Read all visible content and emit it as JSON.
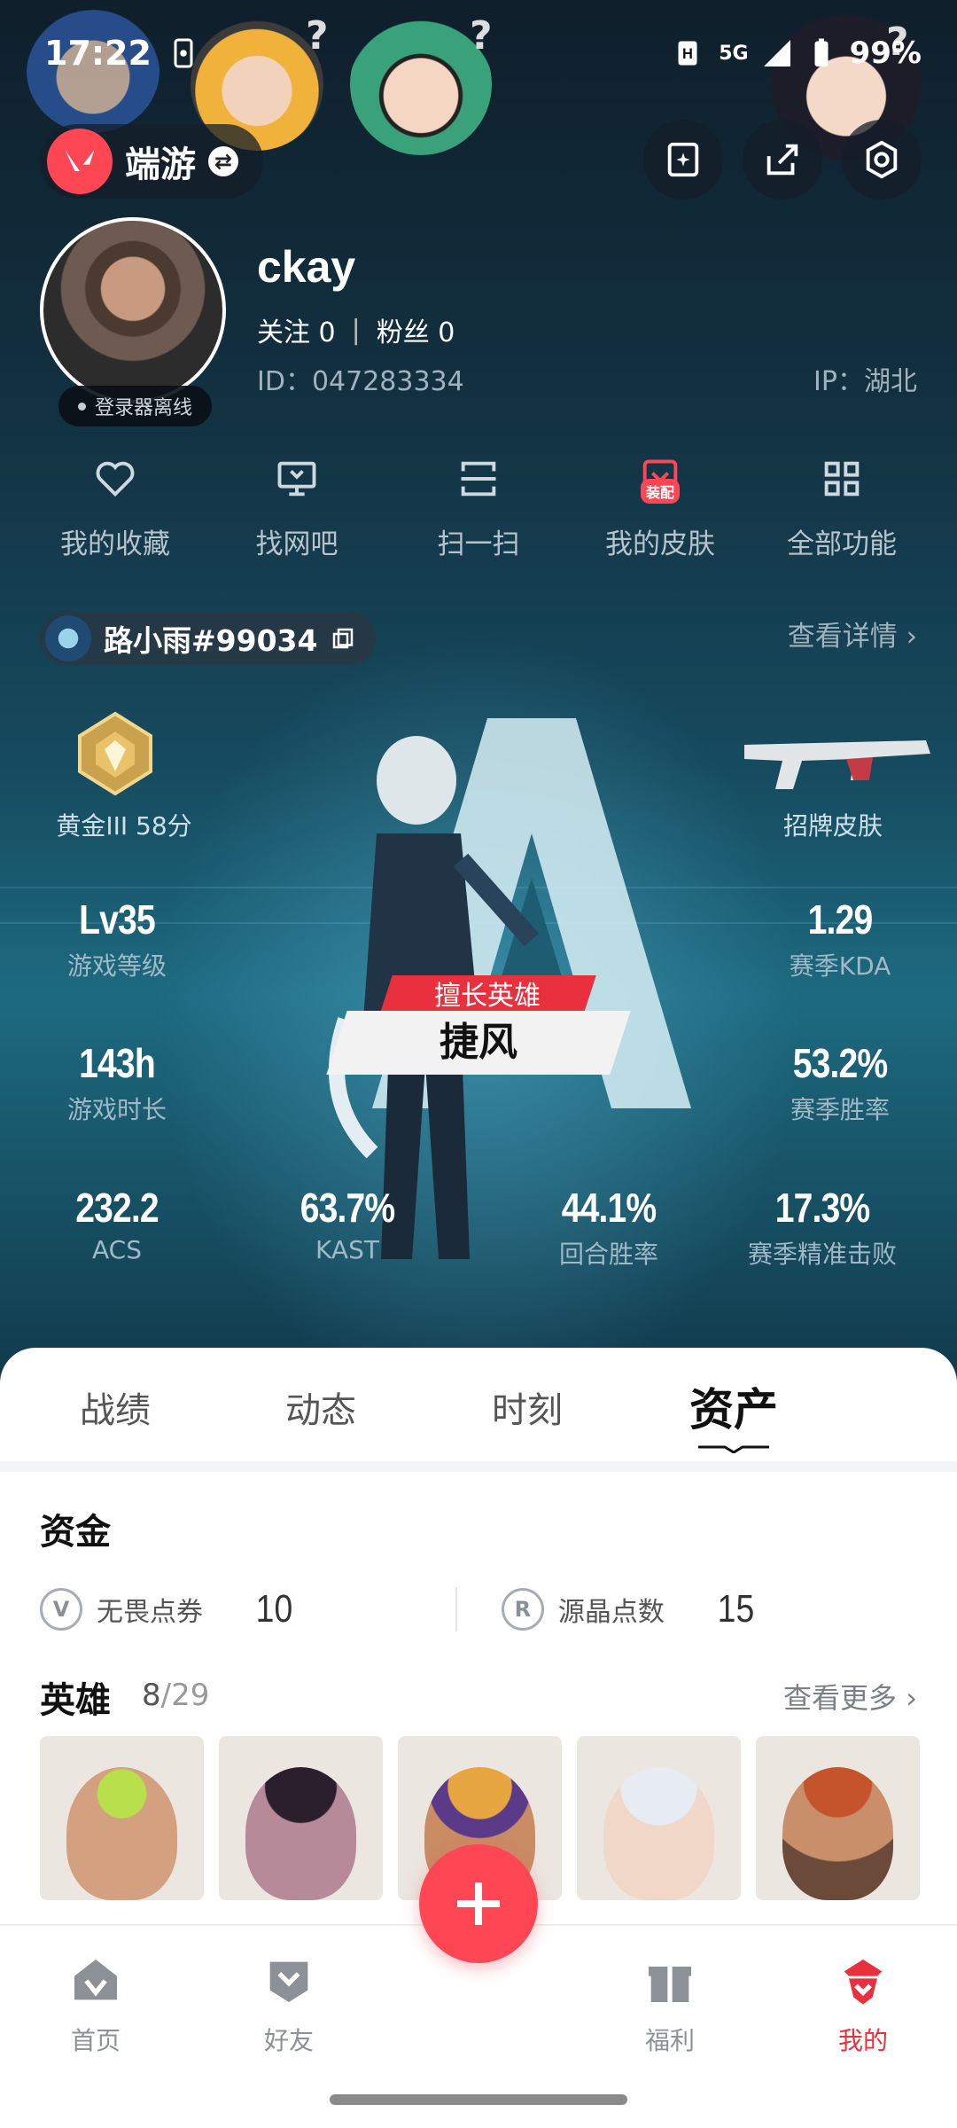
{
  "status_bar": {
    "time": "17:22",
    "network": "5G",
    "battery": "99%"
  },
  "header": {
    "app_name": "端游"
  },
  "profile": {
    "username": "ckay",
    "following_label": "关注",
    "following_count": "0",
    "fans_label": "粉丝",
    "fans_count": "0",
    "id_text": "ID：047283334",
    "ip_text": "IP：湖北",
    "offline_status": "登录器离线"
  },
  "quick_functions": [
    {
      "label": "我的收藏",
      "icon": "heart-icon"
    },
    {
      "label": "找网吧",
      "icon": "monitor-icon"
    },
    {
      "label": "扫一扫",
      "icon": "scan-icon"
    },
    {
      "label": "我的皮肤",
      "icon": "skin-icon",
      "badge": "装配"
    },
    {
      "label": "全部功能",
      "icon": "grid-icon"
    }
  ],
  "game_account": {
    "name": "路小雨#99034",
    "view_detail": "查看详情"
  },
  "stats": {
    "rank": {
      "label": "黄金III 58分"
    },
    "skin": {
      "label": "招牌皮肤"
    },
    "level": {
      "value": "Lv35",
      "label": "游戏等级"
    },
    "kda": {
      "value": "1.29",
      "label": "赛季KDA"
    },
    "play_time": {
      "value": "143h",
      "label": "游戏时长"
    },
    "win_rate": {
      "value": "53.2%",
      "label": "赛季胜率"
    },
    "acs": {
      "value": "232.2",
      "label": "ACS"
    },
    "kast": {
      "value": "63.7%",
      "label": "KAST"
    },
    "round_win": {
      "value": "44.1%",
      "label": "回合胜率"
    },
    "headshot": {
      "value": "17.3%",
      "label": "赛季精准击败"
    }
  },
  "best_hero": {
    "tag": "擅长英雄",
    "name": "捷风"
  },
  "tabs": [
    {
      "label": "战绩"
    },
    {
      "label": "动态"
    },
    {
      "label": "时刻"
    },
    {
      "label": "资产",
      "active": true
    }
  ],
  "assets": {
    "funds_title": "资金",
    "vp_label": "无畏点券",
    "vp_value": "10",
    "rp_label": "源晶点数",
    "rp_value": "15",
    "heroes_title": "英雄",
    "heroes_owned": "8",
    "heroes_total": "/29",
    "see_more": "查看更多"
  },
  "bottom_nav": [
    {
      "label": "首页",
      "icon": "home-icon"
    },
    {
      "label": "好友",
      "icon": "friends-icon"
    },
    {
      "label": "福利",
      "icon": "gift-icon"
    },
    {
      "label": "我的",
      "icon": "profile-icon",
      "active": true
    }
  ],
  "colors": {
    "accent": "#ff4655",
    "active_nav": "#e8303e",
    "hero_bg": "#164a5e"
  }
}
